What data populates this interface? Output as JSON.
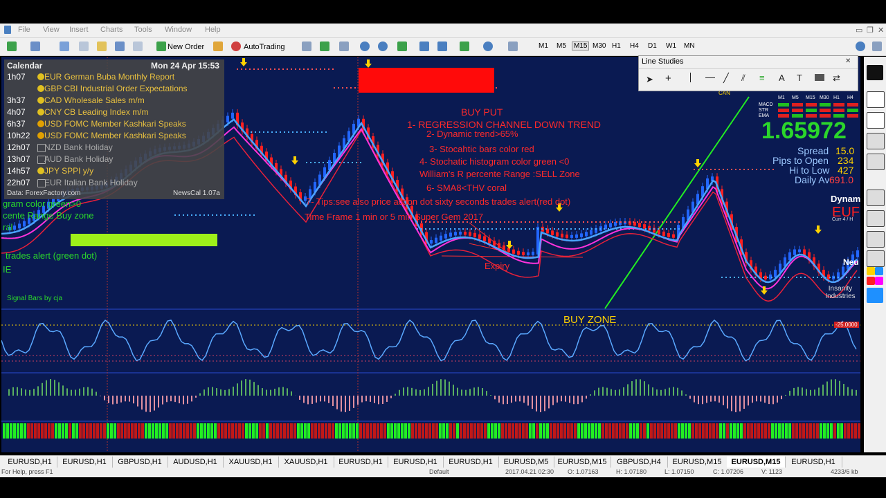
{
  "menu": [
    "File",
    "View",
    "Insert",
    "Charts",
    "Tools",
    "Window",
    "Help"
  ],
  "toolbar": {
    "new_order": "New Order",
    "autotrading": "AutoTrading",
    "timeframes": [
      "M1",
      "M5",
      "M15",
      "M30",
      "H1",
      "H4",
      "D1",
      "W1",
      "MN"
    ],
    "active_timeframe": "M15"
  },
  "calendar": {
    "title": "Calendar",
    "date": "Mon 24 Apr 15:53",
    "rows": [
      {
        "time": "1h07",
        "event": "EUR German Buba Monthly Report",
        "impact": "high"
      },
      {
        "time": "",
        "event": "GBP CBI Industrial Order Expectations",
        "impact": "medium"
      },
      {
        "time": "3h37",
        "event": "CAD Wholesale Sales m/m",
        "impact": "high"
      },
      {
        "time": "4h07",
        "event": "CNY CB Leading Index m/m",
        "impact": "medium"
      },
      {
        "time": "6h37",
        "event": "USD FOMC Member Kashkari Speaks",
        "impact": "speech"
      },
      {
        "time": "10h22",
        "event": "USD FOMC Member Kashkari Speaks",
        "impact": "speech"
      },
      {
        "time": "12h07",
        "event": "NZD  Bank Holiday",
        "impact": "holiday"
      },
      {
        "time": "13h07",
        "event": "AUD  Bank Holiday",
        "impact": "holiday"
      },
      {
        "time": "14h57",
        "event": "JPY  SPPI y/y",
        "impact": "low"
      },
      {
        "time": "22h07",
        "event": "EUR  Italian Bank Holiday",
        "impact": "holiday"
      }
    ],
    "footer_left": "Data: ForexFactory.com",
    "footer_right": "NewsCal 1.07a"
  },
  "left_notes": {
    "line1": "gram color green>0",
    "line2": "cente Range Buy zone",
    "line3": "ral",
    "line4": "trades alert  (green dot)",
    "line5": "IE",
    "signal_bars": "Signal Bars by cja"
  },
  "annotations": {
    "title": "BUY PUT",
    "rules": [
      "1- REGRESSION CHANNEL DOWN TREND",
      "2- Dynamic trend>65%",
      "3- Stocahtic bars color red",
      "4- Stochatic histogram color green <0",
      "William's R percente Range :SELL Zone",
      "6- SMA8<THV coral"
    ],
    "tip_line1": "7- Tips:see also price action dot sixty seconds trades alert(red dot)",
    "tip_line2": "Time Frame 1 min or 5 min Super Gem 2017",
    "expiry": "Expiry",
    "buy_zone": "BUY ZONE",
    "level_label": "-25.0000"
  },
  "right_panel": {
    "price": "1.65972",
    "spread_label": "Spread",
    "spread_value": "15.0",
    "pips_label": "Pips to Open",
    "pips_value": "234",
    "hilo_label": "Hi to Low",
    "hilo_value": "427",
    "daily_label": "Daily Av",
    "daily_value": "691.0",
    "dynam": "Dynam",
    "eur": "EUF",
    "curr": "Curr 4 / H",
    "neu": "Neu",
    "can": "CAN",
    "tfs": [
      "M1",
      "M5",
      "M15",
      "M30",
      "H1",
      "H4"
    ],
    "rows": [
      "MACD",
      "STR",
      "EMA"
    ],
    "watermark": "Insanity Industries"
  },
  "line_studies": {
    "title": "Line Studies"
  },
  "tabs": [
    "EURUSD,H1",
    "EURUSD,H1",
    "GBPUSD,H1",
    "AUDUSD,H1",
    "XAUUSD,H1",
    "XAUUSD,H1",
    "EURUSD,H1",
    "EURUSD,H1",
    "EURUSD,H1",
    "EURUSD,M5",
    "EURUSD,M15",
    "GBPUSD,H4",
    "EURUSD,M15",
    "EURUSD,M15",
    "EURUSD,H1"
  ],
  "active_tab": 13,
  "status": {
    "help": "For Help, press F1",
    "profile": "Default",
    "time": "2017.04.21 02:30",
    "open": "O: 1.07163",
    "high": "H: 1.07180",
    "low": "L: 1.07150",
    "close": "C: 1.07206",
    "vol": "V: 1123",
    "traffic": "4233/6 kb"
  },
  "colors": {
    "chart_bg": "#0a1a52",
    "bull": "#2266ff",
    "bear": "#ff2020",
    "ma_blue": "#4aa3ff",
    "ma_magenta": "#ff33dd",
    "ma_red": "#e8203a",
    "annotation": "#ff2a2a",
    "green_text": "#2bd62b",
    "yellow": "#ffd200"
  }
}
